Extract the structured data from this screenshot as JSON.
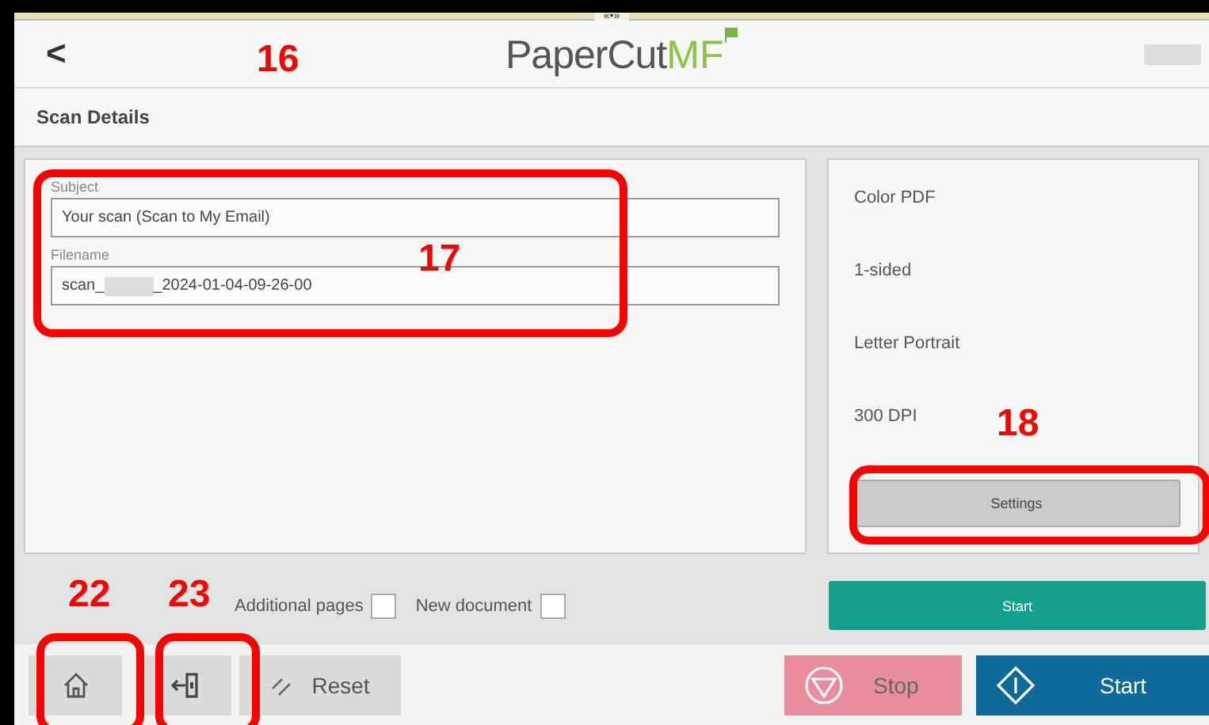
{
  "top_handle": "«•»",
  "header": {
    "back": "<",
    "logo_main": "PaperCut",
    "logo_accent": "MF",
    "user_redacted": true
  },
  "page_title": "Scan Details",
  "fields": [
    {
      "label": "Subject",
      "value_prefix": "Your scan (Scan to My Email)",
      "redacted": false
    },
    {
      "label": "Filename",
      "value_prefix": "scan_",
      "redacted": true,
      "value_suffix": "_2024-01-04-09-26-00"
    }
  ],
  "summary": [
    "Color PDF",
    "1-sided",
    "Letter Portrait",
    "300 DPI"
  ],
  "settings_button": "Settings",
  "options": [
    {
      "label": "Additional pages",
      "checked": false
    },
    {
      "label": "New document",
      "checked": false
    }
  ],
  "start_small": "Start",
  "bottom": {
    "reset": "Reset",
    "stop": "Stop",
    "start": "Start"
  },
  "annotations": [
    {
      "number": "16",
      "kind": "label"
    },
    {
      "number": "17",
      "kind": "boxed"
    },
    {
      "number": "18",
      "kind": "boxed"
    },
    {
      "number": "22",
      "kind": "boxed"
    },
    {
      "number": "23",
      "kind": "boxed"
    }
  ]
}
